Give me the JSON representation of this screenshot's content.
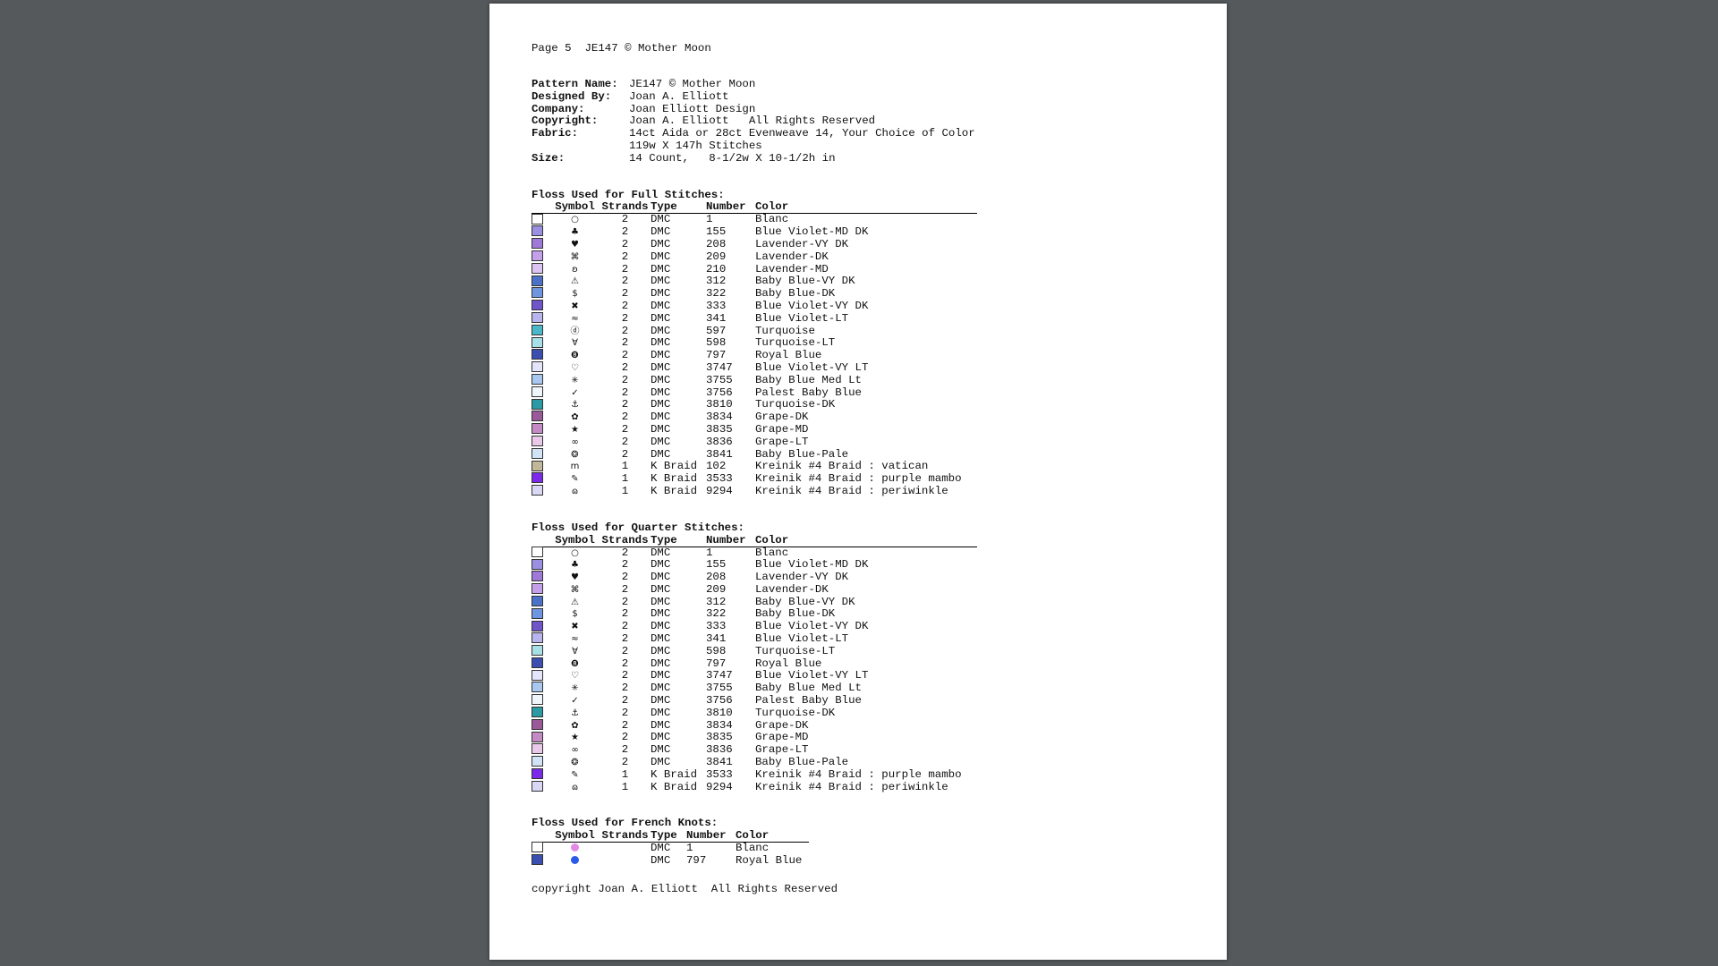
{
  "header": "Page 5  JE147 © Mother Moon",
  "meta": [
    {
      "key": "Pattern Name:",
      "value": "JE147 © Mother Moon"
    },
    {
      "key": "Designed By:",
      "value": "Joan A. Elliott"
    },
    {
      "key": "Company:",
      "value": "Joan Elliott Design"
    },
    {
      "key": "Copyright:",
      "value": "Joan A. Elliott   All Rights Reserved"
    },
    {
      "key": "Fabric:",
      "value": "14ct Aida or 28ct Evenweave 14, Your Choice of Color"
    },
    {
      "key": "",
      "value": "119w X 147h Stitches"
    },
    {
      "key": "Size:",
      "value": "14 Count,   8-1/2w X 10-1/2h in"
    }
  ],
  "columns": {
    "symbol": "Symbol",
    "strands": "Strands",
    "type": "Type",
    "number": "Number",
    "color": "Color"
  },
  "full": {
    "title": "Floss Used for Full Stitches:",
    "rows": [
      {
        "sw": "#ffffff",
        "sym": "○",
        "st": "2",
        "type": "DMC",
        "num": "1",
        "color": "Blanc"
      },
      {
        "sw": "#9a8fe0",
        "sym": "♣",
        "st": "2",
        "type": "DMC",
        "num": "155",
        "color": "Blue Violet-MD DK"
      },
      {
        "sw": "#a079d8",
        "sym": "♥",
        "st": "2",
        "type": "DMC",
        "num": "208",
        "color": "Lavender-VY DK"
      },
      {
        "sw": "#c5a0ea",
        "sym": "⌘",
        "st": "2",
        "type": "DMC",
        "num": "209",
        "color": "Lavender-DK"
      },
      {
        "sw": "#dcc3f2",
        "sym": "ʚ",
        "st": "2",
        "type": "DMC",
        "num": "210",
        "color": "Lavender-MD"
      },
      {
        "sw": "#4b72c8",
        "sym": "⚠",
        "st": "2",
        "type": "DMC",
        "num": "312",
        "color": "Baby Blue-VY DK"
      },
      {
        "sw": "#6d95e0",
        "sym": "$",
        "st": "2",
        "type": "DMC",
        "num": "322",
        "color": "Baby Blue-DK"
      },
      {
        "sw": "#7055c8",
        "sym": "✖",
        "st": "2",
        "type": "DMC",
        "num": "333",
        "color": "Blue Violet-VY DK"
      },
      {
        "sw": "#b8b4ee",
        "sym": "≈",
        "st": "2",
        "type": "DMC",
        "num": "341",
        "color": "Blue Violet-LT"
      },
      {
        "sw": "#4ab8c8",
        "sym": "ⓓ",
        "st": "2",
        "type": "DMC",
        "num": "597",
        "color": "Turquoise"
      },
      {
        "sw": "#a8e0e8",
        "sym": "∀",
        "st": "2",
        "type": "DMC",
        "num": "598",
        "color": "Turquoise-LT"
      },
      {
        "sw": "#3a4fb0",
        "sym": "❽",
        "st": "2",
        "type": "DMC",
        "num": "797",
        "color": "Royal Blue"
      },
      {
        "sw": "#e4e4fa",
        "sym": "♡",
        "st": "2",
        "type": "DMC",
        "num": "3747",
        "color": "Blue Violet-VY LT"
      },
      {
        "sw": "#a8c8f0",
        "sym": "✳",
        "st": "2",
        "type": "DMC",
        "num": "3755",
        "color": "Baby Blue Med Lt"
      },
      {
        "sw": "#eef6fc",
        "sym": "✓",
        "st": "2",
        "type": "DMC",
        "num": "3756",
        "color": "Palest Baby Blue"
      },
      {
        "sw": "#2a9aa4",
        "sym": "⚓",
        "st": "2",
        "type": "DMC",
        "num": "3810",
        "color": "Turquoise-DK"
      },
      {
        "sw": "#9a5a9a",
        "sym": "✿",
        "st": "2",
        "type": "DMC",
        "num": "3834",
        "color": "Grape-DK"
      },
      {
        "sw": "#c48ac4",
        "sym": "★",
        "st": "2",
        "type": "DMC",
        "num": "3835",
        "color": "Grape-MD"
      },
      {
        "sw": "#eac8ea",
        "sym": "∞",
        "st": "2",
        "type": "DMC",
        "num": "3836",
        "color": "Grape-LT"
      },
      {
        "sw": "#d0e4f6",
        "sym": "❂",
        "st": "2",
        "type": "DMC",
        "num": "3841",
        "color": "Baby Blue-Pale"
      },
      {
        "sw": "#c0b898",
        "sym": "m",
        "st": "1",
        "type": "K Braid",
        "num": "102",
        "color": "Kreinik #4 Braid : vatican"
      },
      {
        "sw": "#7a2ae8",
        "sym": "✎",
        "st": "1",
        "type": "K Braid",
        "num": "3533",
        "color": "Kreinik #4 Braid : purple mambo"
      },
      {
        "sw": "#d8d8f4",
        "sym": "ɷ",
        "st": "1",
        "type": "K Braid",
        "num": "9294",
        "color": "Kreinik #4 Braid : periwinkle"
      }
    ]
  },
  "quarter": {
    "title": "Floss Used for Quarter Stitches:",
    "rows": [
      {
        "sw": "#ffffff",
        "sym": "○",
        "st": "2",
        "type": "DMC",
        "num": "1",
        "color": "Blanc"
      },
      {
        "sw": "#9a8fe0",
        "sym": "♣",
        "st": "2",
        "type": "DMC",
        "num": "155",
        "color": "Blue Violet-MD DK"
      },
      {
        "sw": "#a079d8",
        "sym": "♥",
        "st": "2",
        "type": "DMC",
        "num": "208",
        "color": "Lavender-VY DK"
      },
      {
        "sw": "#c5a0ea",
        "sym": "⌘",
        "st": "2",
        "type": "DMC",
        "num": "209",
        "color": "Lavender-DK"
      },
      {
        "sw": "#4b72c8",
        "sym": "⚠",
        "st": "2",
        "type": "DMC",
        "num": "312",
        "color": "Baby Blue-VY DK"
      },
      {
        "sw": "#6d95e0",
        "sym": "$",
        "st": "2",
        "type": "DMC",
        "num": "322",
        "color": "Baby Blue-DK"
      },
      {
        "sw": "#7055c8",
        "sym": "✖",
        "st": "2",
        "type": "DMC",
        "num": "333",
        "color": "Blue Violet-VY DK"
      },
      {
        "sw": "#b8b4ee",
        "sym": "≈",
        "st": "2",
        "type": "DMC",
        "num": "341",
        "color": "Blue Violet-LT"
      },
      {
        "sw": "#a8e0e8",
        "sym": "∀",
        "st": "2",
        "type": "DMC",
        "num": "598",
        "color": "Turquoise-LT"
      },
      {
        "sw": "#3a4fb0",
        "sym": "❽",
        "st": "2",
        "type": "DMC",
        "num": "797",
        "color": "Royal Blue"
      },
      {
        "sw": "#e4e4fa",
        "sym": "♡",
        "st": "2",
        "type": "DMC",
        "num": "3747",
        "color": "Blue Violet-VY LT"
      },
      {
        "sw": "#a8c8f0",
        "sym": "✳",
        "st": "2",
        "type": "DMC",
        "num": "3755",
        "color": "Baby Blue Med Lt"
      },
      {
        "sw": "#eef6fc",
        "sym": "✓",
        "st": "2",
        "type": "DMC",
        "num": "3756",
        "color": "Palest Baby Blue"
      },
      {
        "sw": "#2a9aa4",
        "sym": "⚓",
        "st": "2",
        "type": "DMC",
        "num": "3810",
        "color": "Turquoise-DK"
      },
      {
        "sw": "#9a5a9a",
        "sym": "✿",
        "st": "2",
        "type": "DMC",
        "num": "3834",
        "color": "Grape-DK"
      },
      {
        "sw": "#c48ac4",
        "sym": "★",
        "st": "2",
        "type": "DMC",
        "num": "3835",
        "color": "Grape-MD"
      },
      {
        "sw": "#eac8ea",
        "sym": "∞",
        "st": "2",
        "type": "DMC",
        "num": "3836",
        "color": "Grape-LT"
      },
      {
        "sw": "#d0e4f6",
        "sym": "❂",
        "st": "2",
        "type": "DMC",
        "num": "3841",
        "color": "Baby Blue-Pale"
      },
      {
        "sw": "#7a2ae8",
        "sym": "✎",
        "st": "1",
        "type": "K Braid",
        "num": "3533",
        "color": "Kreinik #4 Braid : purple mambo"
      },
      {
        "sw": "#d8d8f4",
        "sym": "ɷ",
        "st": "1",
        "type": "K Braid",
        "num": "9294",
        "color": "Kreinik #4 Braid : periwinkle"
      }
    ]
  },
  "french": {
    "title": "Floss Used for French Knots:",
    "rows": [
      {
        "sw": "#ffffff",
        "dot": "#e08ae6",
        "st": "",
        "type": "DMC",
        "num": "1",
        "color": "Blanc"
      },
      {
        "sw": "#3a4fb0",
        "dot": "#2a5ae8",
        "st": "",
        "type": "DMC",
        "num": "797",
        "color": "Royal Blue"
      }
    ]
  },
  "footer": "copyright Joan A. Elliott  All Rights Reserved"
}
